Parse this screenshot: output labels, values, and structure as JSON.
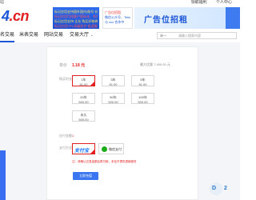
{
  "topbar": {
    "left": "站",
    "links": [
      "领取福利",
      "个人中心"
    ]
  },
  "logo": {
    "text": "4",
    "suffix": ".cn"
  },
  "ads": {
    "red_lines": [
      "标记应用支持国外国内/账号·价格",
      "标记应用可找客户国际化、合作",
      "标记应用支持·企业 购买好物券",
      "标记应用CPU高级防护·极速服务"
    ],
    "white_lines": [
      "广告位招租",
      "微信公众号、Telegram频道",
      "与 xxx 合作中"
    ],
    "banner": "广告位招租"
  },
  "nav": {
    "items": [
      "名交易",
      "米表交易",
      "网站交易",
      "交易大厅"
    ],
    "search_category": "米一",
    "search_placeholder": "请输入搜索内容"
  },
  "purchase": {
    "price_label": "单价",
    "price_value": "1.18 元",
    "discount_text": "最大优惠 7,490.00 元",
    "duration_label": "购买时长",
    "options": [
      {
        "qty": "1年",
        "price": "81.00"
      },
      {
        "qty": "3年",
        "price": "81.00"
      },
      {
        "qty": "5年",
        "price": "81.00"
      },
      {
        "qty": "20年",
        "price": "500.00"
      },
      {
        "qty": "50年",
        "price": "500.00"
      },
      {
        "qty": "100年",
        "price": "500.00"
      },
      {
        "qty": "永久",
        "price": "500.00"
      }
    ],
    "amount_label": "应付金额",
    "amount_value": "1",
    "pay_label": "支付方式",
    "pay_alipay": "支付宝",
    "pay_wechat": "微信支付",
    "note": "注：请确认交易金额后再付款，本站不提供退款服务",
    "submit": "立即充值"
  },
  "chat_badge": "2"
}
